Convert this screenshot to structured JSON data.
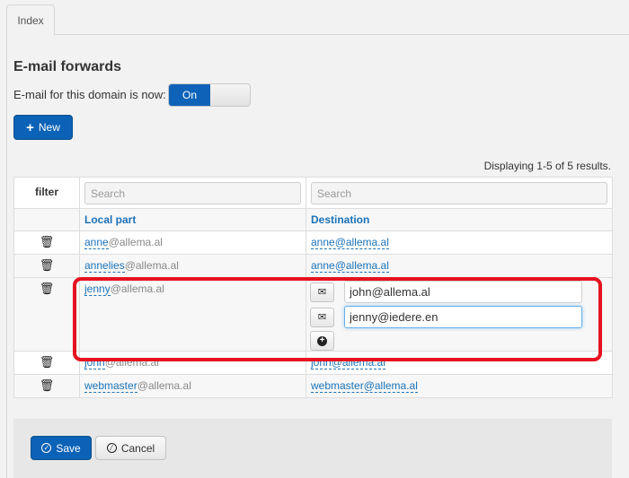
{
  "tabs": [
    {
      "label": "Index"
    }
  ],
  "section_title": "E-mail forwards",
  "domain_status": {
    "label": "E-mail for this domain is now:",
    "value": "On"
  },
  "new_button": {
    "label": "New"
  },
  "results_text": "Displaying 1-5 of 5 results.",
  "table": {
    "filter_label": "filter",
    "search_placeholder_local": "Search",
    "search_placeholder_dest": "Search",
    "columns": [
      "Local part",
      "Destination"
    ],
    "rows": [
      {
        "local": "anne",
        "domain": "@allema.al",
        "destination": "anne@allema.al"
      },
      {
        "local": "annelies",
        "domain": "@allema.al",
        "destination": "anne@allema.al"
      },
      {
        "local": "jenny",
        "domain": "@allema.al",
        "destinations": [
          "john@allema.al",
          "jenny@iedere.en"
        ]
      },
      {
        "local": "john",
        "domain": "@allema.al",
        "destination": "john@allema.al"
      },
      {
        "local": "webmaster",
        "domain": "@allema.al",
        "destination": "webmaster@allema.al"
      }
    ]
  },
  "footer": {
    "save_label": "Save",
    "cancel_label": "Cancel"
  },
  "colors": {
    "primary": "#0b62b6",
    "link": "#1a72b8",
    "highlight": "#e5121f"
  },
  "icons": [
    "trash-icon",
    "envelope-icon",
    "plus-circle-icon",
    "plus-icon",
    "check-circle-icon",
    "cancel-circle-icon"
  ]
}
